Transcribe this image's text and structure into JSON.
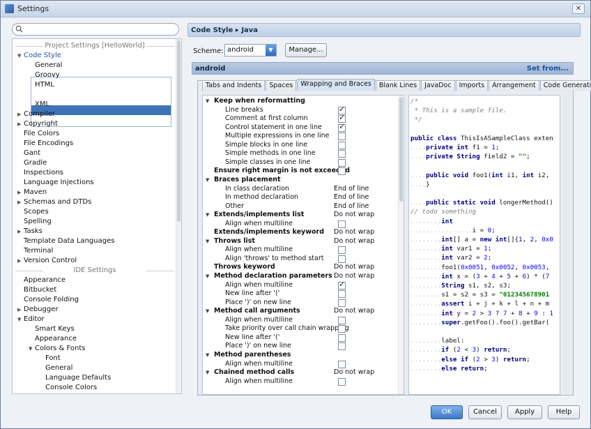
{
  "window": {
    "title": "Settings"
  },
  "search": {
    "placeholder": ""
  },
  "tree": {
    "project_section": "Project Settings [HelloWorld]",
    "ide_section": "IDE Settings",
    "items": [
      {
        "label": "Code Style",
        "indent": 1,
        "arrow": "down",
        "link": true
      },
      {
        "label": "General",
        "indent": 2
      },
      {
        "label": "Groovy",
        "indent": 2
      },
      {
        "label": "HTML",
        "indent": 2
      },
      {
        "label": "Java",
        "indent": 2,
        "selected": true
      },
      {
        "label": "XML",
        "indent": 2
      },
      {
        "label": "Compiler",
        "indent": 1,
        "arrow": "right"
      },
      {
        "label": "Copyright",
        "indent": 1,
        "arrow": "right"
      },
      {
        "label": "File Colors",
        "indent": 1
      },
      {
        "label": "File Encodings",
        "indent": 1
      },
      {
        "label": "Gant",
        "indent": 1
      },
      {
        "label": "Gradle",
        "indent": 1
      },
      {
        "label": "Inspections",
        "indent": 1
      },
      {
        "label": "Language Injections",
        "indent": 1
      },
      {
        "label": "Maven",
        "indent": 1,
        "arrow": "right"
      },
      {
        "label": "Schemas and DTDs",
        "indent": 1,
        "arrow": "right"
      },
      {
        "label": "Scopes",
        "indent": 1
      },
      {
        "label": "Spelling",
        "indent": 1
      },
      {
        "label": "Tasks",
        "indent": 1,
        "arrow": "right"
      },
      {
        "label": "Template Data Languages",
        "indent": 1
      },
      {
        "label": "Terminal",
        "indent": 1
      },
      {
        "label": "Version Control",
        "indent": 1,
        "arrow": "right"
      }
    ],
    "ide_items": [
      {
        "label": "Appearance",
        "indent": 1
      },
      {
        "label": "Bitbucket",
        "indent": 1
      },
      {
        "label": "Console Folding",
        "indent": 1
      },
      {
        "label": "Debugger",
        "indent": 1,
        "arrow": "right"
      },
      {
        "label": "Editor",
        "indent": 1,
        "arrow": "down"
      },
      {
        "label": "Smart Keys",
        "indent": 2
      },
      {
        "label": "Appearance",
        "indent": 2
      },
      {
        "label": "Colors & Fonts",
        "indent": 2,
        "arrow": "down"
      },
      {
        "label": "Font",
        "indent": 3
      },
      {
        "label": "General",
        "indent": 3
      },
      {
        "label": "Language Defaults",
        "indent": 3
      },
      {
        "label": "Console Colors",
        "indent": 3
      }
    ]
  },
  "breadcrumb": "Code Style ▸ Java",
  "scheme": {
    "label": "Scheme:",
    "value": "android",
    "manage_label": "Manage..."
  },
  "scheme_header": {
    "name": "android",
    "set_from": "Set from..."
  },
  "tabs": [
    {
      "label": "Tabs and Indents"
    },
    {
      "label": "Spaces"
    },
    {
      "label": "Wrapping and Braces",
      "active": true
    },
    {
      "label": "Blank Lines"
    },
    {
      "label": "JavaDoc"
    },
    {
      "label": "Imports"
    },
    {
      "label": "Arrangement"
    },
    {
      "label": "Code Generation"
    }
  ],
  "options": [
    {
      "label": "Keep when reformatting",
      "group": true,
      "tri": true
    },
    {
      "label": "Line breaks",
      "check": true
    },
    {
      "label": "Comment at first column",
      "check": true
    },
    {
      "label": "Control statement in one line",
      "check": true
    },
    {
      "label": "Multiple expressions in one line",
      "check": false
    },
    {
      "label": "Simple blocks in one line",
      "check": false
    },
    {
      "label": "Simple methods in one line",
      "check": false
    },
    {
      "label": "Simple classes in one line",
      "check": false
    },
    {
      "label": "Ensure right margin is not exceeded",
      "group": true,
      "check": false
    },
    {
      "label": "Braces placement",
      "group": true,
      "tri": true
    },
    {
      "label": "In class declaration",
      "value": "End of line"
    },
    {
      "label": "In method declaration",
      "value": "End of line"
    },
    {
      "label": "Other",
      "value": "End of line"
    },
    {
      "label": "Extends/implements list",
      "group": true,
      "tri": true,
      "value": "Do not wrap"
    },
    {
      "label": "Align when multiline",
      "check": false
    },
    {
      "label": "Extends/implements keyword",
      "group": true,
      "value": "Do not wrap"
    },
    {
      "label": "Throws list",
      "group": true,
      "tri": true,
      "value": "Do not wrap"
    },
    {
      "label": "Align when multiline",
      "check": false
    },
    {
      "label": "Align 'throws' to method start",
      "check": false
    },
    {
      "label": "Throws keyword",
      "group": true,
      "value": "Do not wrap"
    },
    {
      "label": "Method declaration parameters",
      "group": true,
      "tri": true,
      "value": "Do not wrap"
    },
    {
      "label": "Align when multiline",
      "check": true
    },
    {
      "label": "New line after '('",
      "check": false
    },
    {
      "label": "Place ')' on new line",
      "check": false
    },
    {
      "label": "Method call arguments",
      "group": true,
      "tri": true,
      "value": "Do not wrap"
    },
    {
      "label": "Align when multiline",
      "check": false
    },
    {
      "label": "Take priority over call chain wrapping",
      "check": false
    },
    {
      "label": "New line after '('",
      "check": false
    },
    {
      "label": "Place ')' on new line",
      "check": false
    },
    {
      "label": "Method parentheses",
      "group": true,
      "tri": true
    },
    {
      "label": "Align when multiline",
      "check": false
    },
    {
      "label": "Chained method calls",
      "group": true,
      "tri": true,
      "value": "Do not wrap"
    },
    {
      "label": "Align when multiline",
      "check": false
    }
  ],
  "code_lines": [
    "/*",
    " * This is a sample file.",
    " */",
    "",
    "public class ThisIsASampleClass exten",
    "....private int f1 = 1;",
    "....private String field2 = \"\";",
    "",
    "....public void foo1(int i1, int i2,",
    "....}",
    "",
    "....public static void longerMethod()",
    "// todo something",
    "........int",
    "................i = 0;",
    "........int[] a = new int[]{1, 2, 0x0",
    "........int var1 = 1;",
    "........int var2 = 2;",
    "........foo1(0x0051, 0x0052, 0x0053,",
    "........int x = (3 + 4 + 5 + 6) * (7",
    "........String s1, s2, s3;",
    "........s1 = s2 = s3 = \"012345678901",
    "........assert i + j + k + l + n + m",
    "........int y = 2 > 3 ? 7 + 8 + 9 : 1",
    "........super.getFoo().foo().getBar(",
    "",
    "........label:",
    "........if (2 < 3) return;",
    "........else if (2 > 3) return;",
    "........else return;"
  ],
  "footer": {
    "ok": "OK",
    "cancel": "Cancel",
    "apply": "Apply",
    "help": "Help"
  }
}
